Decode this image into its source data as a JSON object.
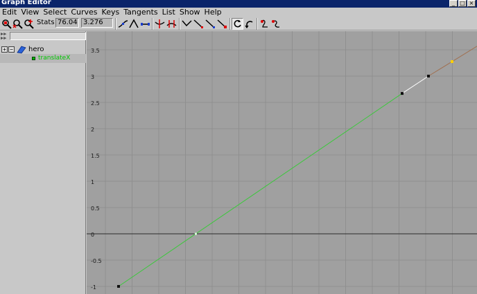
{
  "window": {
    "title": "Graph Editor",
    "buttons": [
      "_",
      "□",
      "×"
    ]
  },
  "menu": [
    "Edit",
    "View",
    "Select",
    "Curves",
    "Keys",
    "Tangents",
    "List",
    "Show",
    "Help"
  ],
  "toolbar": {
    "stats_label": "Stats",
    "frame_value": "76.04",
    "value_value": "3.276",
    "tools": [
      "move-nearest-key-icon",
      "insert-key-icon",
      "add-key-icon",
      "spline-tangent-icon",
      "clamped-tangent-icon",
      "linear-tangent-icon",
      "break-tangents-icon",
      "unify-tangents-icon",
      "free-weight-icon",
      "lock-weight-icon",
      "stepped-tangent-icon",
      "flat-tangent-icon",
      "buffer-curve-snapshot-icon",
      "swap-buffer-curve-icon",
      "pre-infinity-icon",
      "post-infinity-icon"
    ]
  },
  "outliner": {
    "object": "hero",
    "attribute": "translateX"
  },
  "graph": {
    "y_ticks": [
      "3.5",
      "3",
      "2.5",
      "2",
      "1.5",
      "1",
      "0.5",
      "0",
      "-0.5",
      "-1"
    ],
    "background": "#a0a0a0",
    "grid_color": "#8f8f8f",
    "curve_color": "#3cc83c",
    "selected_segment_color": "#ffffff",
    "post_infinity_color": "#a07050",
    "keys": [
      {
        "value": -1.0,
        "selected": false
      },
      {
        "value": 2.67,
        "selected": false
      },
      {
        "value": 3.0,
        "selected": false
      },
      {
        "value": 3.276,
        "selected": true
      }
    ]
  }
}
